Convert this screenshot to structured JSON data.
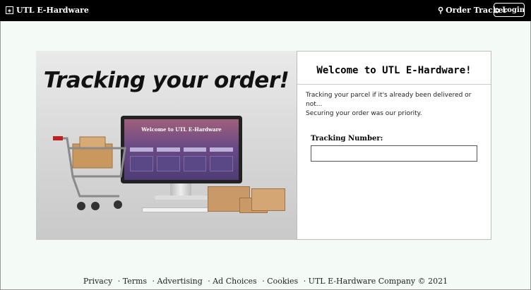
{
  "header": {
    "brand": "UTL E-Hardware",
    "tracker_label": "Order Tracker",
    "login_label": "Login"
  },
  "hero": {
    "headline": "Tracking your order!",
    "screen_title": "Welcome to UTL E-Hardware"
  },
  "panel": {
    "welcome": "Welcome to UTL E-Hardware!",
    "line1": "Tracking your parcel if it's already been delivered or not...",
    "line2": "Securing your order was our priority.",
    "tracking_label": "Tracking Number:",
    "tracking_value": ""
  },
  "footer": {
    "privacy": "Privacy",
    "terms": "· Terms",
    "advertising": "· Advertising",
    "ad_choices": "· Ad Choices",
    "cookies": "· Cookies",
    "company": "· UTL E-Hardware Company © 2021"
  },
  "icons": {
    "brand": "cube-logo-icon",
    "tracker": "search-icon",
    "login": "login-icon"
  },
  "colors": {
    "header_bg": "#000000",
    "page_bg": "#f4fbf6",
    "panel_bg": "#ffffff"
  }
}
